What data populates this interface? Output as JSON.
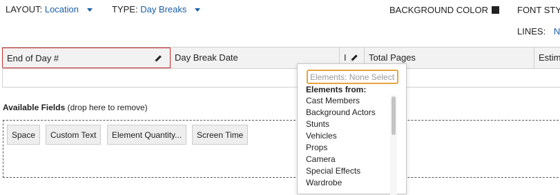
{
  "toolbar": {
    "layout_label": "LAYOUT:",
    "layout_value": "Location",
    "type_label": "TYPE:",
    "type_value": "Day Breaks",
    "background_color_label": "BACKGROUND COLOR",
    "background_color": "#222222",
    "font_style_label": "FONT STYL",
    "lines_label": "LINES:",
    "lines_value": "No"
  },
  "columns": [
    {
      "label": "End of Day #"
    },
    {
      "label": "Day Break Date"
    },
    {
      "label": "I"
    },
    {
      "label": "Total Pages"
    },
    {
      "label": "Estima"
    }
  ],
  "available": {
    "title": "Available Fields",
    "hint": "(drop here to remove)",
    "fields": [
      "Space",
      "Custom Text",
      "Element Quantity...",
      "Screen Time"
    ]
  },
  "elements_dropdown": {
    "placeholder": "Elements: None Selected",
    "group_label": "Elements from:",
    "options": [
      "Cast Members",
      "Background Actors",
      "Stunts",
      "Vehicles",
      "Props",
      "Camera",
      "Special Effects",
      "Wardrobe"
    ]
  },
  "icons": {
    "column_edit": "pencil-icon",
    "dropdown_caret": "chevron-down-icon"
  }
}
